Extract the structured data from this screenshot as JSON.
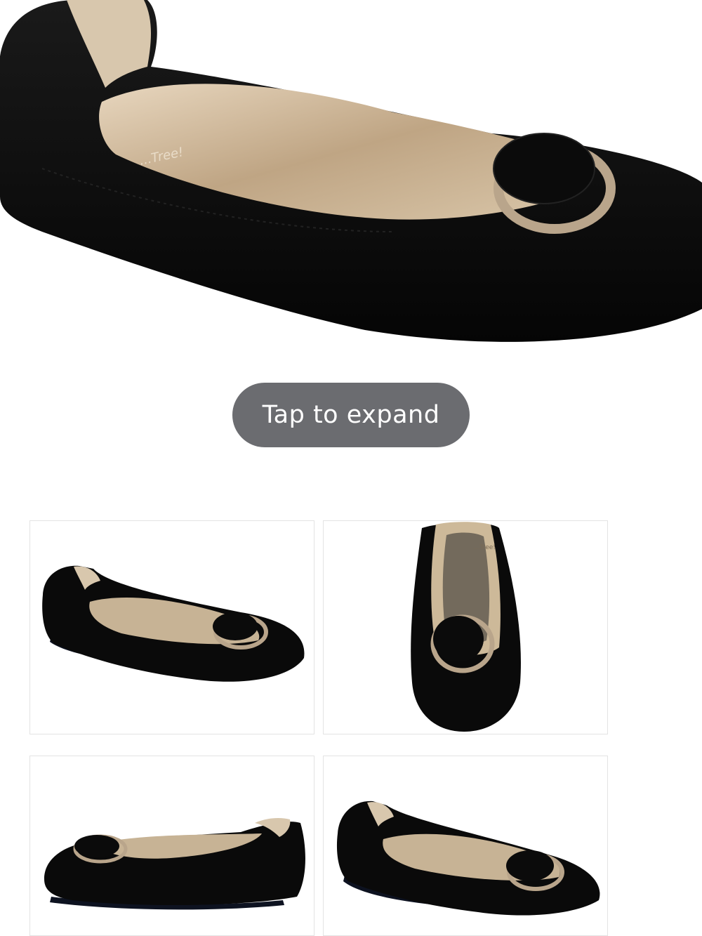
{
  "hero": {
    "brand_mark": "...Tree!",
    "alt": "product-photo"
  },
  "expand_button": {
    "label": "Tap to expand"
  },
  "thumbnails": [
    {
      "name": "side-view"
    },
    {
      "name": "top-view",
      "brand_mark": "...Tree!"
    },
    {
      "name": "inner-side-view"
    },
    {
      "name": "angled-view"
    }
  ],
  "colors": {
    "suede": "#0a0a0a",
    "lining": "#c9b79c",
    "button_bg": "#6b6c70",
    "button_text": "#ffffff"
  }
}
